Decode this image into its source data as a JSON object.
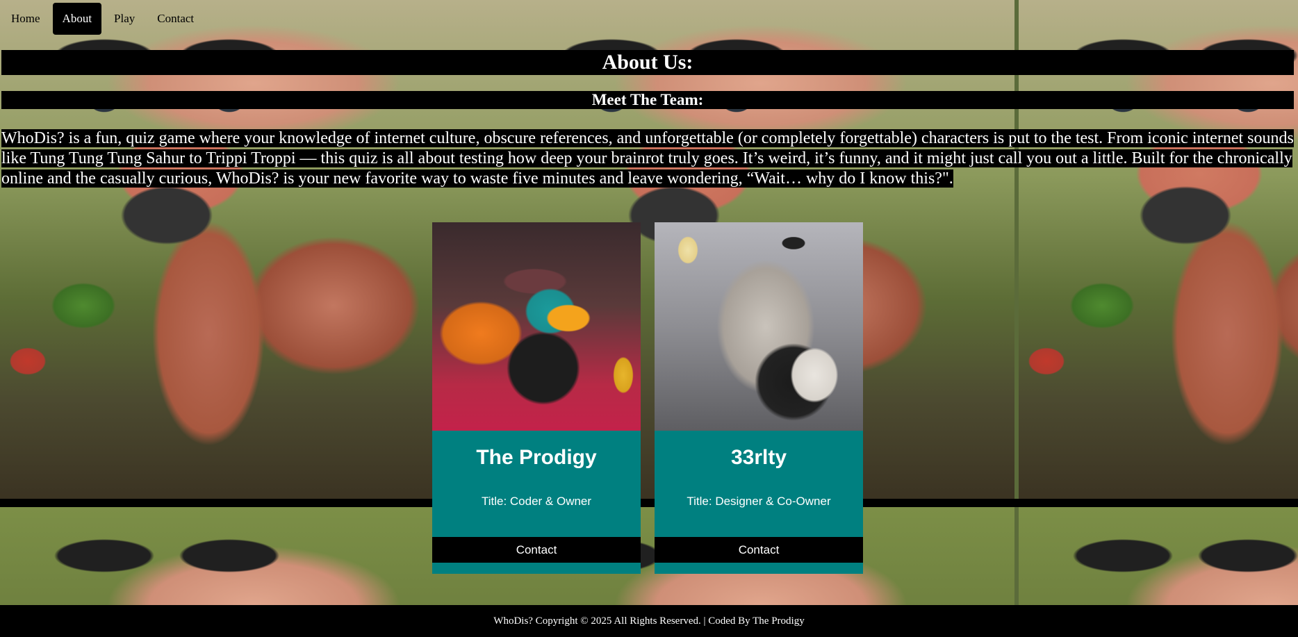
{
  "nav": {
    "items": [
      {
        "label": "Home"
      },
      {
        "label": "About"
      },
      {
        "label": "Play"
      },
      {
        "label": "Contact"
      }
    ],
    "active": "About"
  },
  "about": {
    "heading": "About Us:",
    "subheading": "Meet The Team:",
    "intro": "WhoDis? is a fun, quiz game where your knowledge of internet culture, obscure references, and unforgettable (or completely forgettable) characters is put to the test. From iconic internet sounds like Tung Tung Tung Sahur to Trippi Troppi — this quiz is all about testing how deep your brainrot truly goes. It’s weird, it’s funny, and it might just call you out a little. Built for the chronically online and the casually curious, WhoDis? is your new favorite way to waste five minutes and leave wondering, “Wait… why do I know this?\"."
  },
  "team": [
    {
      "name": "The Prodigy",
      "title": "Title: Coder & Owner",
      "contact_label": "Contact"
    },
    {
      "name": "33rlty",
      "title": "Title: Designer & Co-Owner",
      "contact_label": "Contact"
    }
  ],
  "footer": {
    "text": "WhoDis? Copyright © 2025 All Rights Reserved. | Coded By The Prodigy"
  },
  "colors": {
    "card_bg": "#008080",
    "bar_bg": "#000000",
    "text": "#ffffff"
  }
}
